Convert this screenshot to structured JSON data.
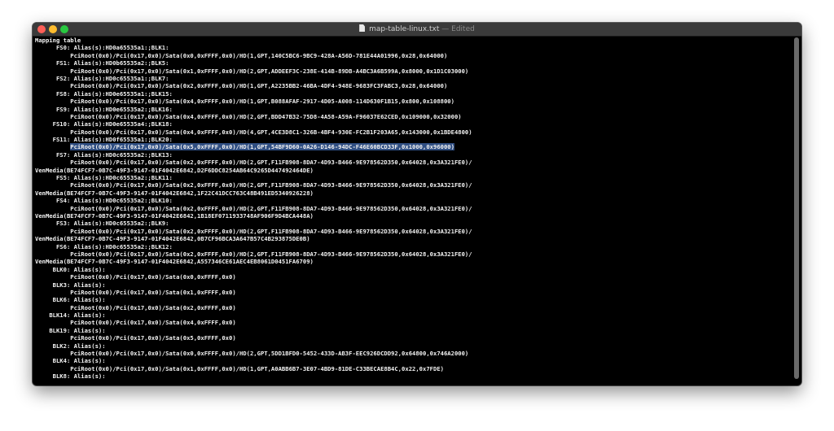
{
  "window": {
    "filename": "map-table-linux.txt",
    "separator": "—",
    "status": "Edited"
  },
  "lines": [
    {
      "indent": 0,
      "text": "Mapping table"
    },
    {
      "indent": 6,
      "text": "FS0: Alias(s):HD0a65535a1:;BLK1:"
    },
    {
      "indent": 10,
      "text": "PciRoot(0x0)/Pci(0x17,0x0)/Sata(0x0,0xFFFF,0x0)/HD(1,GPT,140C5BC6-9BC9-428A-A56D-781E44A01996,0x28,0x64000)"
    },
    {
      "indent": 6,
      "text": "FS1: Alias(s):HD0b65535a2:;BLK5:"
    },
    {
      "indent": 10,
      "text": "PciRoot(0x0)/Pci(0x17,0x0)/Sata(0x1,0xFFFF,0x0)/HD(2,GPT,ADDEEF3C-238E-414B-89DB-A4BC3A6B599A,0x8000,0x1D1C03000)"
    },
    {
      "indent": 6,
      "text": "FS2: Alias(s):HD0c65535a1:;BLK7:"
    },
    {
      "indent": 10,
      "text": "PciRoot(0x0)/Pci(0x17,0x0)/Sata(0x2,0xFFFF,0x0)/HD(1,GPT,A2235BB2-46BA-4DF4-948E-9683FC3FABC3,0x28,0x64000)"
    },
    {
      "indent": 6,
      "text": "FS8: Alias(s):HD0e65535a1:;BLK15:"
    },
    {
      "indent": 10,
      "text": "PciRoot(0x0)/Pci(0x17,0x0)/Sata(0x4,0xFFFF,0x0)/HD(1,GPT,B088AFAF-2917-4D05-A008-114D630F1B15,0x800,0x108800)"
    },
    {
      "indent": 6,
      "text": "FS9: Alias(s):HD0e65535a2:;BLK16:"
    },
    {
      "indent": 10,
      "text": "PciRoot(0x0)/Pci(0x17,0x0)/Sata(0x4,0xFFFF,0x0)/HD(2,GPT,BDD47B32-75D8-4A58-A59A-F96037E62CED,0x109000,0x32000)"
    },
    {
      "indent": 5,
      "text": "FS10: Alias(s):HD0e65535a4:;BLK18:"
    },
    {
      "indent": 10,
      "text": "PciRoot(0x0)/Pci(0x17,0x0)/Sata(0x4,0xFFFF,0x0)/HD(4,GPT,4CE3D8C1-326B-4BF4-930E-FC2B1F203A65,0x143000,0x1BDE4800)"
    },
    {
      "indent": 5,
      "text": "FS11: Alias(s):HD0f65535a1:;BLK20:"
    },
    {
      "indent": 10,
      "text": "PciRoot(0x0)/Pci(0x17,0x0)/Sata(0x5,0xFFFF,0x0)/HD(1,GPT,54BF9D60-0A26-D146-94DC-F46E60BCD33F,0x1000,0x96000)",
      "highlight": true
    },
    {
      "indent": 6,
      "text": "FS7: Alias(s):HD0c65535a2:;BLK13:"
    },
    {
      "indent": 10,
      "text": "PciRoot(0x0)/Pci(0x17,0x0)/Sata(0x2,0xFFFF,0x0)/HD(2,GPT,F11FB908-8DA7-4D93-B466-9E978562D350,0x64028,0x3A321FE0)/"
    },
    {
      "indent": 0,
      "text": "VenMedia(BE74FCF7-0B7C-49F3-9147-01F4042E6842,D2F6DDC8254AB64C9265D447492464DE)"
    },
    {
      "indent": 6,
      "text": "FS5: Alias(s):HD0c65535a2:;BLK11:"
    },
    {
      "indent": 10,
      "text": "PciRoot(0x0)/Pci(0x17,0x0)/Sata(0x2,0xFFFF,0x0)/HD(2,GPT,F11FB908-8DA7-4D93-B466-9E978562D350,0x64028,0x3A321FE0)/"
    },
    {
      "indent": 0,
      "text": "VenMedia(BE74FCF7-0B7C-49F3-9147-01F4042E6842,1F22C41DCC763C48B491ED5340926228)"
    },
    {
      "indent": 6,
      "text": "FS4: Alias(s):HD0c65535a2:;BLK10:"
    },
    {
      "indent": 10,
      "text": "PciRoot(0x0)/Pci(0x17,0x0)/Sata(0x2,0xFFFF,0x0)/HD(2,GPT,F11FB908-8DA7-4D93-B466-9E978562D350,0x64028,0x3A321FE0)/"
    },
    {
      "indent": 0,
      "text": "VenMedia(BE74FCF7-0B7C-49F3-9147-01F4042E6842,1B18EF0711933748AF906F9D4BCA448A)"
    },
    {
      "indent": 6,
      "text": "FS3: Alias(s):HD0c65535a2:;BLK9:"
    },
    {
      "indent": 10,
      "text": "PciRoot(0x0)/Pci(0x17,0x0)/Sata(0x2,0xFFFF,0x0)/HD(2,GPT,F11FB908-8DA7-4D93-B466-9E978562D350,0x64028,0x3A321FE0)/"
    },
    {
      "indent": 0,
      "text": "VenMedia(BE74FCF7-0B7C-49F3-9147-01F4042E6842,0B7CF96BCA3A647B57C4B293875DE0B)"
    },
    {
      "indent": 6,
      "text": "FS6: Alias(s):HD0c65535a2:;BLK12:"
    },
    {
      "indent": 10,
      "text": "PciRoot(0x0)/Pci(0x17,0x0)/Sata(0x2,0xFFFF,0x0)/HD(2,GPT,F11FB908-8DA7-4D93-B466-9E978562D350,0x64028,0x3A321FE0)/"
    },
    {
      "indent": 0,
      "text": "VenMedia(BE74FCF7-0B7C-49F3-9147-01F4042E6842,A557346CE61AEC4EB8061D0451FA6709)"
    },
    {
      "indent": 5,
      "text": "BLK0: Alias(s):"
    },
    {
      "indent": 10,
      "text": "PciRoot(0x0)/Pci(0x17,0x0)/Sata(0x0,0xFFFF,0x0)"
    },
    {
      "indent": 5,
      "text": "BLK3: Alias(s):"
    },
    {
      "indent": 10,
      "text": "PciRoot(0x0)/Pci(0x17,0x0)/Sata(0x1,0xFFFF,0x0)"
    },
    {
      "indent": 5,
      "text": "BLK6: Alias(s):"
    },
    {
      "indent": 10,
      "text": "PciRoot(0x0)/Pci(0x17,0x0)/Sata(0x2,0xFFFF,0x0)"
    },
    {
      "indent": 4,
      "text": "BLK14: Alias(s):"
    },
    {
      "indent": 10,
      "text": "PciRoot(0x0)/Pci(0x17,0x0)/Sata(0x4,0xFFFF,0x0)"
    },
    {
      "indent": 4,
      "text": "BLK19: Alias(s):"
    },
    {
      "indent": 10,
      "text": "PciRoot(0x0)/Pci(0x17,0x0)/Sata(0x5,0xFFFF,0x0)"
    },
    {
      "indent": 5,
      "text": "BLK2: Alias(s):"
    },
    {
      "indent": 10,
      "text": "PciRoot(0x0)/Pci(0x17,0x0)/Sata(0x0,0xFFFF,0x0)/HD(2,GPT,5DD1BFD0-5452-433D-AB3F-EEC926DCDD92,0x64800,0x746A2000)"
    },
    {
      "indent": 5,
      "text": "BLK4: Alias(s):"
    },
    {
      "indent": 10,
      "text": "PciRoot(0x0)/Pci(0x17,0x0)/Sata(0x1,0xFFFF,0x0)/HD(1,GPT,A0ABB6B7-3E07-4BD9-81DE-C33BECAE8B4C,0x22,0x7FDE)"
    },
    {
      "indent": 5,
      "text": "BLK8: Alias(s):"
    }
  ],
  "colors": {
    "text": "#f2f2f2",
    "background": "#000000",
    "selection": "#2f4e82"
  },
  "icons": [
    "document-icon",
    "close-icon",
    "minimize-icon",
    "maximize-icon"
  ]
}
